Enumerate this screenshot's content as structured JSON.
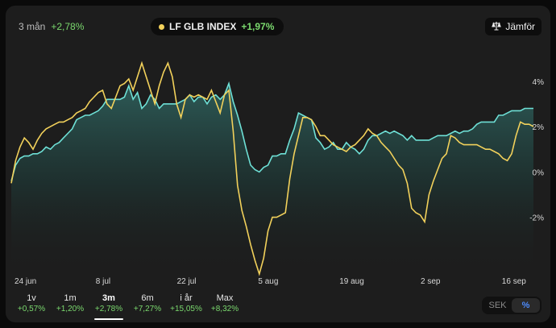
{
  "header": {
    "period_label": "3 mån",
    "period_change": "+2,78%",
    "index_name": "LF GLB INDEX",
    "index_change": "+1,97%",
    "compare_label": "Jämför"
  },
  "periods": [
    {
      "label": "1v",
      "value": "+0,57%"
    },
    {
      "label": "1m",
      "value": "+1,20%"
    },
    {
      "label": "3m",
      "value": "+2,78%"
    },
    {
      "label": "6m",
      "value": "+7,27%"
    },
    {
      "label": "i år",
      "value": "+15,05%"
    },
    {
      "label": "Max",
      "value": "+8,32%"
    }
  ],
  "active_period": "3m",
  "currency_toggle": {
    "options": [
      "SEK",
      "%"
    ],
    "selected": "%"
  },
  "colors": {
    "fund": "#6ee0d6",
    "index": "#f2d15b",
    "positive": "#7bd96e",
    "accent": "#4d8cff"
  },
  "chart_data": {
    "type": "line",
    "x_tick_labels": [
      "24 jun",
      "8 jul",
      "22 jul",
      "5 aug",
      "19 aug",
      "2 sep",
      "16 sep"
    ],
    "y_tick_labels": [
      "4%",
      "2%",
      "0%",
      "-2%"
    ],
    "ylim": [
      -4.5,
      5.2
    ],
    "series": [
      {
        "id": "fund",
        "values": [
          -0.4,
          0.3,
          0.6,
          0.7,
          0.7,
          0.8,
          0.8,
          0.9,
          1.1,
          1.0,
          1.2,
          1.3,
          1.5,
          1.7,
          1.9,
          2.3,
          2.4,
          2.5,
          2.5,
          2.6,
          2.7,
          2.9,
          3.2,
          3.2,
          3.2,
          3.2,
          3.3,
          3.8,
          3.2,
          3.5,
          2.8,
          3.0,
          3.4,
          3.2,
          2.8,
          3.0,
          3.0,
          3.0,
          3.0,
          3.1,
          3.2,
          3.4,
          3.1,
          3.3,
          3.3,
          3.0,
          3.3,
          3.4,
          3.2,
          3.4,
          3.9,
          3.1,
          2.5,
          1.8,
          1.0,
          0.3,
          0.1,
          0.0,
          0.2,
          0.3,
          0.7,
          0.7,
          0.8,
          0.8,
          1.4,
          1.9,
          2.6,
          2.5,
          2.4,
          2.3,
          1.5,
          1.3,
          1.0,
          1.1,
          1.3,
          1.0,
          1.0,
          1.3,
          1.1,
          1.0,
          0.8,
          1.0,
          1.4,
          1.6,
          1.6,
          1.7,
          1.8,
          1.7,
          1.8,
          1.7,
          1.6,
          1.4,
          1.6,
          1.4,
          1.4,
          1.4,
          1.4,
          1.5,
          1.6,
          1.6,
          1.6,
          1.7,
          1.8,
          1.7,
          1.8,
          1.8,
          1.9,
          2.1,
          2.2,
          2.2,
          2.2,
          2.2,
          2.5,
          2.5,
          2.6,
          2.7,
          2.7,
          2.7,
          2.8,
          2.8,
          2.8
        ]
      },
      {
        "id": "index",
        "values": [
          -0.5,
          0.5,
          1.1,
          1.5,
          1.3,
          1.0,
          1.4,
          1.7,
          1.9,
          2.0,
          2.1,
          2.2,
          2.2,
          2.3,
          2.4,
          2.6,
          2.7,
          2.8,
          3.1,
          3.3,
          3.5,
          3.6,
          3.0,
          2.8,
          3.3,
          3.8,
          3.9,
          4.1,
          3.6,
          4.2,
          4.8,
          4.2,
          3.6,
          3.0,
          3.8,
          4.4,
          4.8,
          4.2,
          3.0,
          2.4,
          3.2,
          3.4,
          3.3,
          3.4,
          3.3,
          3.2,
          3.6,
          3.1,
          2.6,
          3.4,
          3.6,
          1.8,
          -0.6,
          -1.7,
          -2.4,
          -3.2,
          -3.9,
          -4.5,
          -3.8,
          -2.6,
          -2.0,
          -2.0,
          -1.9,
          -1.8,
          -0.3,
          0.8,
          1.6,
          2.4,
          2.4,
          2.3,
          2.0,
          1.6,
          1.6,
          1.4,
          1.2,
          1.1,
          1.0,
          0.9,
          1.1,
          1.2,
          1.4,
          1.6,
          1.9,
          1.7,
          1.6,
          1.3,
          1.1,
          0.9,
          0.6,
          0.3,
          0.1,
          -0.5,
          -1.6,
          -1.8,
          -1.9,
          -2.2,
          -1.0,
          -0.4,
          0.1,
          0.6,
          0.8,
          1.6,
          1.5,
          1.3,
          1.2,
          1.2,
          1.2,
          1.2,
          1.1,
          1.0,
          1.0,
          0.9,
          0.8,
          0.6,
          0.5,
          0.8,
          1.6,
          2.2,
          2.1,
          2.1,
          2.0
        ]
      }
    ]
  }
}
